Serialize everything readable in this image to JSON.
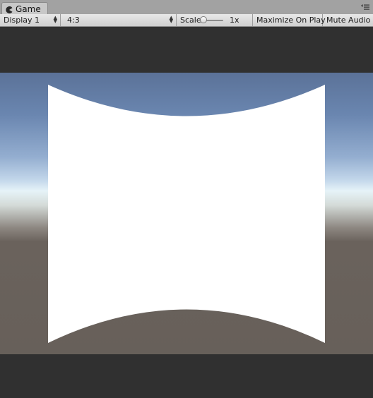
{
  "tab": {
    "title": "Game",
    "icon": "game-pacman-icon"
  },
  "tab_menu_icon": "options-menu-icon",
  "toolbar": {
    "display": "Display 1",
    "aspect": "4:3",
    "scale_label": "Scale",
    "scale_value": "1x",
    "maximize_label": "Maximize On Play",
    "mute_label": "Mute Audio"
  },
  "colors": {
    "panel_background": "#303030",
    "sky_top": "#5b7298",
    "horizon": "#e6f3f8",
    "ground": "#67605a",
    "surface": "#ffffff"
  }
}
